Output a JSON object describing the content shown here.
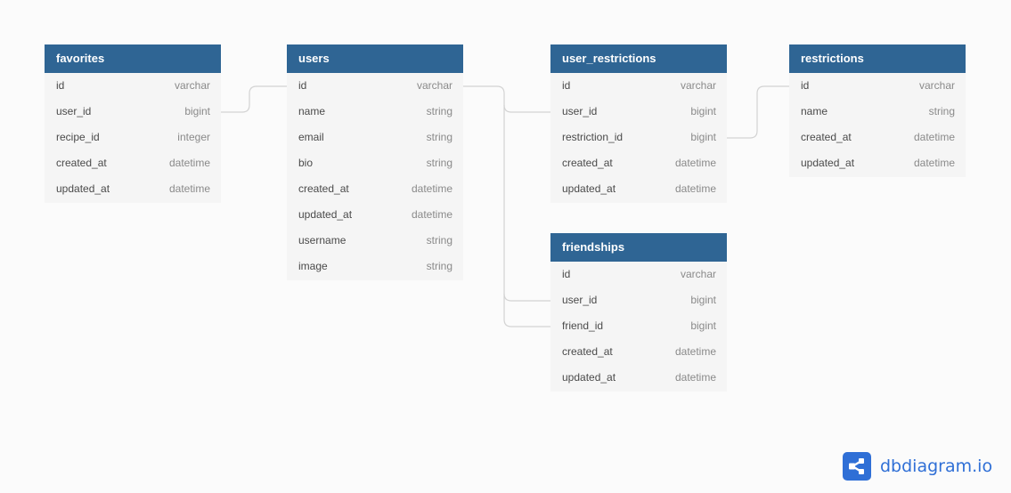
{
  "tables": {
    "favorites": {
      "name": "favorites",
      "fields": [
        {
          "name": "id",
          "type": "varchar"
        },
        {
          "name": "user_id",
          "type": "bigint"
        },
        {
          "name": "recipe_id",
          "type": "integer"
        },
        {
          "name": "created_at",
          "type": "datetime"
        },
        {
          "name": "updated_at",
          "type": "datetime"
        }
      ]
    },
    "users": {
      "name": "users",
      "fields": [
        {
          "name": "id",
          "type": "varchar"
        },
        {
          "name": "name",
          "type": "string"
        },
        {
          "name": "email",
          "type": "string"
        },
        {
          "name": "bio",
          "type": "string"
        },
        {
          "name": "created_at",
          "type": "datetime"
        },
        {
          "name": "updated_at",
          "type": "datetime"
        },
        {
          "name": "username",
          "type": "string"
        },
        {
          "name": "image",
          "type": "string"
        }
      ]
    },
    "user_restrictions": {
      "name": "user_restrictions",
      "fields": [
        {
          "name": "id",
          "type": "varchar"
        },
        {
          "name": "user_id",
          "type": "bigint"
        },
        {
          "name": "restriction_id",
          "type": "bigint"
        },
        {
          "name": "created_at",
          "type": "datetime"
        },
        {
          "name": "updated_at",
          "type": "datetime"
        }
      ]
    },
    "restrictions": {
      "name": "restrictions",
      "fields": [
        {
          "name": "id",
          "type": "varchar"
        },
        {
          "name": "name",
          "type": "string"
        },
        {
          "name": "created_at",
          "type": "datetime"
        },
        {
          "name": "updated_at",
          "type": "datetime"
        }
      ]
    },
    "friendships": {
      "name": "friendships",
      "fields": [
        {
          "name": "id",
          "type": "varchar"
        },
        {
          "name": "user_id",
          "type": "bigint"
        },
        {
          "name": "friend_id",
          "type": "bigint"
        },
        {
          "name": "created_at",
          "type": "datetime"
        },
        {
          "name": "updated_at",
          "type": "datetime"
        }
      ]
    }
  },
  "relationships": [
    {
      "from": "favorites.user_id",
      "to": "users.id"
    },
    {
      "from": "user_restrictions.user_id",
      "to": "users.id"
    },
    {
      "from": "user_restrictions.restriction_id",
      "to": "restrictions.id"
    },
    {
      "from": "friendships.user_id",
      "to": "users.id"
    },
    {
      "from": "friendships.friend_id",
      "to": "users.id"
    }
  ],
  "colors": {
    "header": "#2f6594",
    "brand": "#2f6fd6",
    "link": "#d6d6d6"
  },
  "brand": {
    "name": "dbdiagram.io",
    "icon": "share-icon"
  }
}
